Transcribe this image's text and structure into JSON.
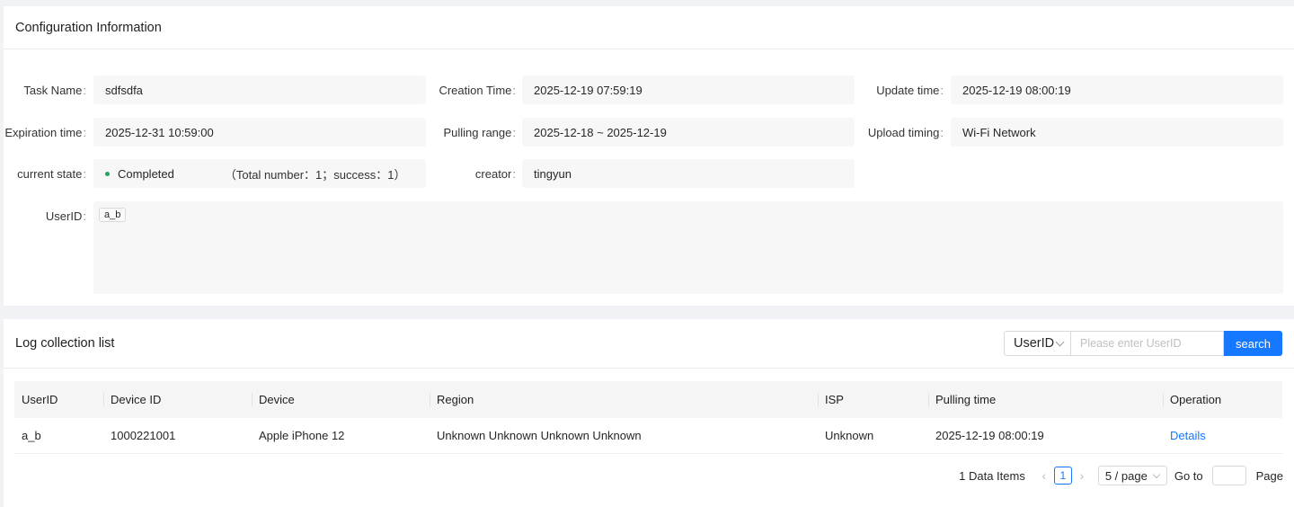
{
  "config": {
    "title": "Configuration Information",
    "fields": {
      "task_name": {
        "label": "Task Name",
        "value": "sdfsdfa"
      },
      "creation_time": {
        "label": "Creation Time",
        "value": "2025-12-19 07:59:19"
      },
      "update_time": {
        "label": "Update time",
        "value": "2025-12-19 08:00:19"
      },
      "expiration_time": {
        "label": "Expiration time",
        "value": "2025-12-31 10:59:00"
      },
      "pulling_range": {
        "label": "Pulling range",
        "value": "2025-12-18 ~ 2025-12-19"
      },
      "upload_timing": {
        "label": "Upload timing",
        "value": "Wi-Fi Network"
      },
      "current_state": {
        "label": "current state",
        "value": "Completed",
        "extra": "（Total number：1；success：1）",
        "color": "#26a65b"
      },
      "creator": {
        "label": "creator",
        "value": "tingyun"
      },
      "userid": {
        "label": "UserID",
        "tags": [
          "a_b"
        ]
      }
    }
  },
  "log": {
    "title": "Log collection list",
    "search": {
      "select_value": "UserID",
      "placeholder": "Please enter UserID",
      "button_label": "search"
    },
    "columns": [
      "UserID",
      "Device ID",
      "Device",
      "Region",
      "ISP",
      "Pulling time",
      "Operation"
    ],
    "rows": [
      {
        "userid": "a_b",
        "device_id": "1000221001",
        "device": "Apple iPhone 12",
        "region": "Unknown Unknown Unknown Unknown",
        "isp": "Unknown",
        "pulling_time": "2025-12-19 08:00:19",
        "operation": "Details"
      }
    ],
    "pagination": {
      "total": "1 Data Items",
      "current_page": "1",
      "page_size": "5 / page",
      "goto_label": "Go to",
      "page_label": "Page",
      "prev_icon": "chevron-left-icon",
      "next_icon": "chevron-right-icon"
    }
  },
  "colors": {
    "accent": "#1677ff",
    "success": "#26a65b"
  }
}
